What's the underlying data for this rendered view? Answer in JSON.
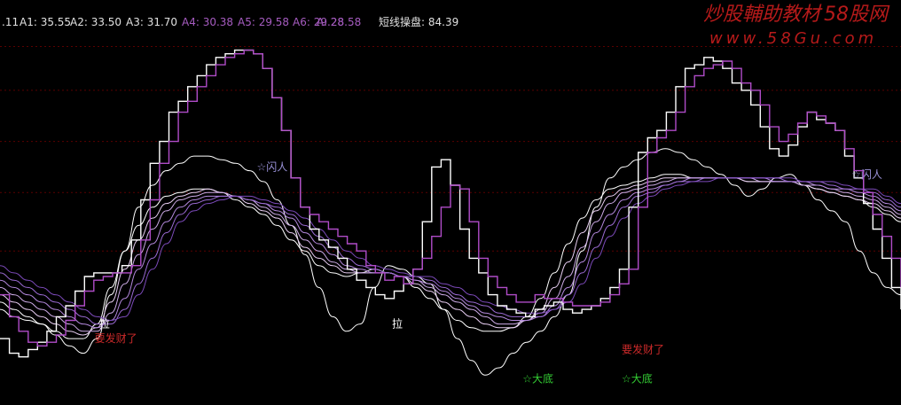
{
  "header": {
    "indicator_prefix": ".11",
    "a1": "A1: 35.55",
    "a2": "A2: 33.50",
    "a3": "A3: 31.70",
    "a4": "A4: 30.38",
    "a5": "A5: 29.58",
    "a6": "A6: 29.28",
    "a": "A: 28.58",
    "title_label": "短线操盘: 84.39"
  },
  "watermark": {
    "brand": "炒股輔助教材",
    "brand_suffix": "58股网",
    "url": "www.58Gu.com"
  },
  "colors": {
    "background": "#000000",
    "grid": "#5a0000",
    "white_line": "#ffffff",
    "purple_line": "#b04cc8",
    "header_white": "#e0e0e0",
    "header_purple": "#a65cc0",
    "watermark_red": "#b71a1a",
    "signal_red": "#cc2a2a",
    "signal_green": "#33cc33",
    "signal_purple": "#9a92d8"
  },
  "chart_data": {
    "type": "line",
    "ylim": [
      0,
      100
    ],
    "grid": "horizontal dotted",
    "x": [
      0,
      1,
      2,
      3,
      4,
      5,
      6,
      7,
      8,
      9,
      10,
      11,
      12,
      13,
      14,
      15,
      16,
      17,
      18,
      19,
      20,
      21,
      22,
      23,
      24,
      25,
      26,
      27,
      28,
      29,
      30,
      31,
      32,
      33,
      34,
      35,
      36,
      37,
      38,
      39,
      40,
      41,
      42,
      43,
      44,
      45,
      46,
      47,
      48,
      49,
      50,
      51,
      52,
      53,
      54,
      55,
      56,
      57,
      58,
      59,
      60,
      61,
      62,
      63,
      64,
      65,
      66,
      67,
      68,
      69,
      70,
      71,
      72,
      73,
      74,
      75,
      76,
      77,
      78,
      79,
      80,
      81,
      82,
      83,
      84,
      85,
      86,
      87,
      88,
      89,
      90,
      91,
      92,
      93,
      94,
      95,
      96,
      97,
      98,
      99,
      100
    ],
    "step_series": [
      {
        "key": "A1",
        "color": "#ffffff",
        "values": [
          16,
          12,
          11,
          13,
          15,
          18,
          22,
          25,
          29,
          33,
          34,
          34,
          34,
          36,
          43,
          54,
          64,
          70,
          78,
          81,
          85,
          88,
          91,
          93,
          94,
          95,
          95,
          94,
          90,
          82,
          73,
          60,
          52,
          46,
          43,
          41,
          38,
          35,
          32,
          30,
          28,
          27,
          29,
          31,
          35,
          48,
          63,
          65,
          58,
          46,
          38,
          34,
          28,
          25,
          24,
          23,
          22,
          24,
          25,
          26,
          24,
          23,
          24,
          25,
          27,
          30,
          35,
          52,
          67,
          71,
          73,
          78,
          85,
          90,
          91,
          93,
          92,
          90,
          86,
          84,
          80,
          74,
          68,
          66,
          69,
          74,
          78,
          76,
          75,
          73,
          66,
          60,
          53,
          46,
          38,
          30,
          24
        ]
      },
      {
        "key": "A",
        "color": "#b04cc8",
        "values": [
          28,
          22,
          18,
          15,
          14,
          15,
          17,
          21,
          25,
          29,
          32,
          33,
          34,
          34,
          36,
          43,
          54,
          64,
          70,
          78,
          81,
          85,
          88,
          91,
          93,
          94,
          95,
          94,
          90,
          82,
          73,
          60,
          52,
          50,
          48,
          46,
          44,
          42,
          40,
          36,
          34,
          32,
          33,
          31,
          35,
          38,
          44,
          52,
          58,
          57,
          48,
          38,
          33,
          30,
          28,
          26,
          26,
          28,
          27,
          27,
          26,
          25,
          25,
          25,
          26,
          28,
          31,
          35,
          52,
          67,
          71,
          73,
          78,
          85,
          88,
          90,
          91,
          92,
          90,
          86,
          84,
          80,
          74,
          70,
          72,
          75,
          78,
          77,
          75,
          73,
          68,
          62,
          56,
          50,
          44,
          38,
          30
        ]
      }
    ],
    "smooth_series": [
      {
        "key": "raw",
        "color": "#ffffff",
        "width": 1.0,
        "values": [
          24,
          22,
          21,
          20,
          17,
          14,
          12,
          16,
          28,
          40,
          52,
          58,
          62,
          64,
          66,
          66,
          65,
          64,
          62,
          59,
          54,
          47,
          39,
          30,
          22,
          18,
          20,
          30,
          36,
          35,
          33,
          31,
          24,
          16,
          10,
          6,
          8,
          12,
          15,
          18,
          22,
          28,
          40,
          52,
          60,
          63,
          65,
          67,
          68,
          67,
          65,
          63,
          61,
          58,
          55,
          57,
          60,
          61,
          58,
          54,
          51,
          48,
          40,
          34,
          30,
          28
        ]
      },
      {
        "key": "A2",
        "color": "#ffffff",
        "width": 1.0,
        "values": [
          26,
          24,
          22,
          20,
          18,
          16,
          16,
          20,
          30,
          40,
          47,
          52,
          55,
          56,
          57,
          57,
          56,
          54,
          52,
          50,
          47,
          43,
          40,
          36,
          34,
          33,
          34,
          35,
          34,
          33,
          30,
          27,
          24,
          21,
          19,
          18,
          18,
          19,
          22,
          27,
          34,
          42,
          49,
          54,
          57,
          58,
          59,
          60,
          61,
          61,
          60,
          60,
          60,
          60,
          59,
          59,
          59,
          59,
          58,
          57,
          56,
          55,
          54,
          52,
          50,
          48
        ]
      },
      {
        "key": "A3",
        "color": "#e6ccf0",
        "width": 1.0,
        "values": [
          28,
          26,
          24,
          22,
          20,
          18,
          17,
          19,
          26,
          35,
          43,
          49,
          53,
          55,
          56,
          57,
          56,
          55,
          53,
          51,
          49,
          45,
          41,
          38,
          36,
          34,
          34,
          34,
          34,
          33,
          31,
          29,
          26,
          24,
          22,
          20,
          19,
          19,
          21,
          24,
          30,
          37,
          45,
          51,
          55,
          57,
          58,
          59,
          60,
          60,
          60,
          60,
          60,
          60,
          59,
          59,
          59,
          59,
          58,
          57,
          56,
          55,
          54,
          53,
          51,
          49
        ]
      },
      {
        "key": "A4",
        "color": "#ccaae6",
        "width": 1.0,
        "values": [
          30,
          28,
          26,
          24,
          22,
          20,
          18,
          18,
          23,
          31,
          39,
          46,
          51,
          54,
          55,
          56,
          56,
          55,
          54,
          52,
          50,
          47,
          43,
          40,
          37,
          35,
          34,
          34,
          34,
          33,
          32,
          30,
          28,
          26,
          24,
          22,
          20,
          20,
          21,
          23,
          27,
          33,
          41,
          48,
          53,
          56,
          57,
          58,
          59,
          60,
          60,
          60,
          60,
          60,
          60,
          59,
          59,
          59,
          58,
          58,
          57,
          56,
          55,
          54,
          52,
          50
        ]
      },
      {
        "key": "A5",
        "color": "#b388dc",
        "width": 1.0,
        "values": [
          32,
          30,
          28,
          26,
          24,
          22,
          20,
          19,
          21,
          27,
          35,
          42,
          48,
          52,
          54,
          55,
          55,
          55,
          54,
          53,
          51,
          49,
          45,
          42,
          39,
          36,
          35,
          34,
          34,
          33,
          32,
          31,
          29,
          27,
          25,
          23,
          22,
          21,
          21,
          22,
          25,
          30,
          37,
          45,
          50,
          54,
          56,
          57,
          58,
          59,
          60,
          60,
          60,
          60,
          60,
          60,
          59,
          59,
          59,
          58,
          57,
          57,
          56,
          55,
          53,
          51
        ]
      },
      {
        "key": "A6",
        "color": "#9a6ad2",
        "width": 1.0,
        "values": [
          34,
          32,
          30,
          28,
          26,
          24,
          22,
          20,
          20,
          24,
          31,
          38,
          45,
          50,
          53,
          54,
          55,
          55,
          54,
          53,
          52,
          50,
          47,
          44,
          41,
          38,
          36,
          35,
          34,
          33,
          33,
          32,
          30,
          28,
          26,
          25,
          23,
          22,
          22,
          22,
          24,
          28,
          34,
          41,
          47,
          52,
          55,
          56,
          58,
          59,
          59,
          60,
          60,
          60,
          60,
          60,
          60,
          59,
          59,
          59,
          58,
          57,
          57,
          56,
          54,
          52
        ]
      },
      {
        "key": "A",
        "color": "#7c4aba",
        "width": 1.0,
        "values": [
          36,
          34,
          32,
          30,
          28,
          26,
          24,
          22,
          21,
          22,
          28,
          35,
          42,
          48,
          51,
          53,
          54,
          55,
          55,
          54,
          53,
          51,
          49,
          46,
          43,
          40,
          38,
          36,
          35,
          34,
          33,
          33,
          31,
          30,
          28,
          26,
          25,
          24,
          23,
          23,
          24,
          26,
          31,
          38,
          44,
          49,
          53,
          55,
          57,
          58,
          59,
          59,
          60,
          60,
          60,
          60,
          60,
          60,
          59,
          59,
          59,
          58,
          57,
          57,
          55,
          53
        ]
      }
    ],
    "annotations": [
      {
        "text": "拉",
        "color": "#ffffff",
        "x": 11,
        "y": 19
      },
      {
        "text": "要发财了",
        "color": "#cc2a2a",
        "x": 10.5,
        "y": 15
      },
      {
        "text": "☆闪人",
        "color": "#9a92d8",
        "x": 28.5,
        "y": 62
      },
      {
        "text": "拉",
        "color": "#ffffff",
        "x": 43.5,
        "y": 19
      },
      {
        "text": "☆大底",
        "color": "#33cc33",
        "x": 58,
        "y": 4
      },
      {
        "text": "☆大底",
        "color": "#33cc33",
        "x": 69,
        "y": 4
      },
      {
        "text": "要发财了",
        "color": "#cc2a2a",
        "x": 69,
        "y": 12
      },
      {
        "text": "☆闪人",
        "color": "#9a92d8",
        "x": 94.5,
        "y": 60
      }
    ]
  }
}
